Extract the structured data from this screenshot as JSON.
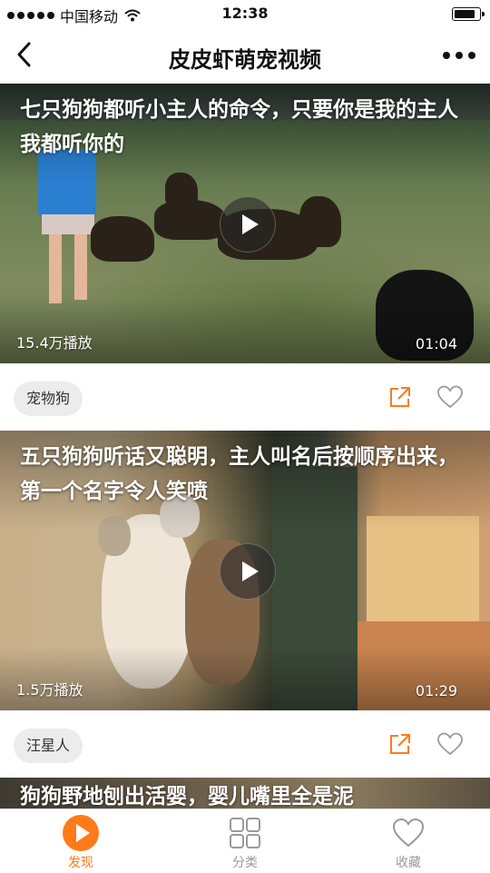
{
  "status_bar": {
    "carrier": "中国移动",
    "time": "12:38"
  },
  "nav": {
    "title": "皮皮虾萌宠视频"
  },
  "feed": [
    {
      "title": "七只狗狗都听小主人的命令，只要你是我的主人我都听你的",
      "plays": "15.4万播放",
      "duration": "01:04",
      "tag": "宠物狗"
    },
    {
      "title": "五只狗狗听话又聪明，主人叫名后按顺序出来，第一个名字令人笑喷",
      "plays": "1.5万播放",
      "duration": "01:29",
      "tag": "汪星人"
    },
    {
      "title": "狗狗野地刨出活婴，婴儿嘴里全是泥"
    }
  ],
  "tabbar": [
    {
      "label": "发现",
      "icon": "play-circle-icon",
      "active": true
    },
    {
      "label": "分类",
      "icon": "grid-icon",
      "active": false
    },
    {
      "label": "收藏",
      "icon": "heart-icon",
      "active": false
    }
  ],
  "colors": {
    "accent": "#ff7a1a",
    "tag_bg": "#ececec",
    "inactive": "#999999"
  }
}
